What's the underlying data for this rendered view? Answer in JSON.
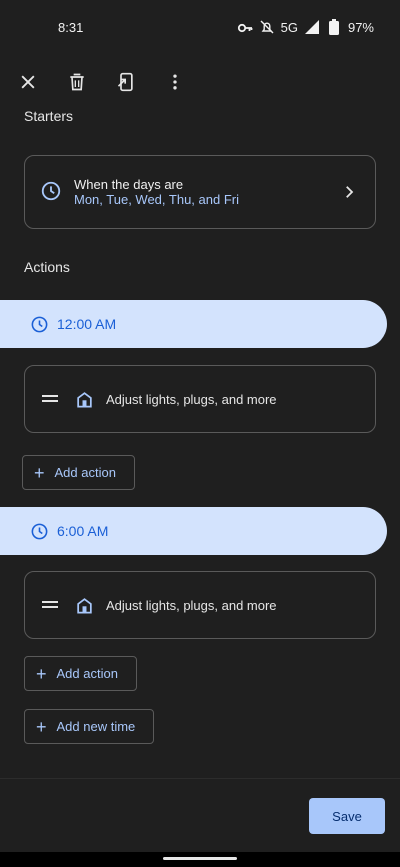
{
  "status_bar": {
    "time": "8:31",
    "network": "5G",
    "battery": "97%"
  },
  "toolbar": {
    "icons": [
      "close-icon",
      "delete-icon",
      "open-in-new-icon",
      "more-vert-icon"
    ]
  },
  "starters": {
    "heading": "Starters",
    "card": {
      "title": "When the days are",
      "subtitle": "Mon, Tue, Wed, Thu, and Fri"
    }
  },
  "actions": {
    "heading": "Actions",
    "groups": [
      {
        "time": "12:00 AM",
        "item_label": "Adjust lights, plugs, and more",
        "add_action_label": "Add action"
      },
      {
        "time": "6:00 AM",
        "item_label": "Adjust lights, plugs, and more",
        "add_action_label": "Add action"
      }
    ],
    "add_new_time_label": "Add new time"
  },
  "footer": {
    "save_label": "Save"
  },
  "colors": {
    "background": "#1f1f1f",
    "accent": "#a8c7fa",
    "pill": "#d3e3fd",
    "pill_text": "#1a5fd6"
  }
}
